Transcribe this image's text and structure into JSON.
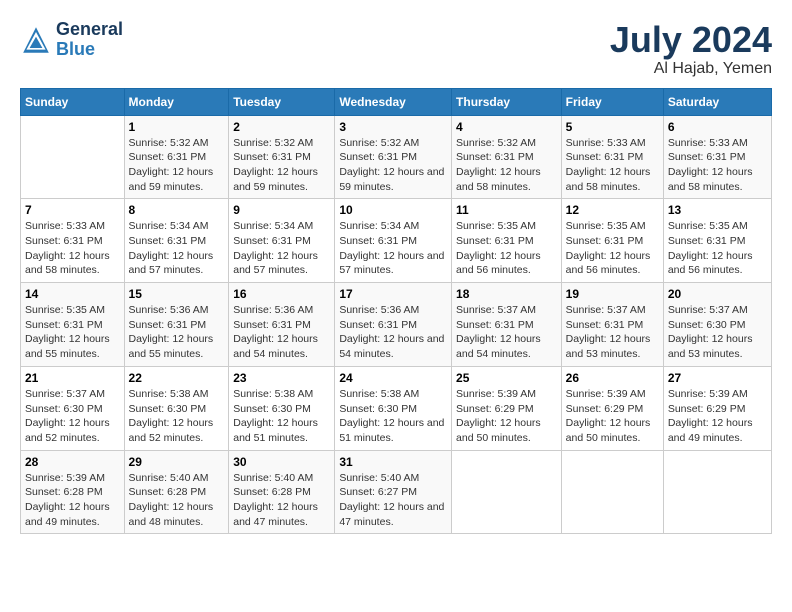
{
  "logo": {
    "general": "General",
    "blue": "Blue"
  },
  "title": {
    "month_year": "July 2024",
    "location": "Al Hajab, Yemen"
  },
  "weekdays": [
    "Sunday",
    "Monday",
    "Tuesday",
    "Wednesday",
    "Thursday",
    "Friday",
    "Saturday"
  ],
  "weeks": [
    [
      {
        "day": "",
        "sunrise": "",
        "sunset": "",
        "daylight": ""
      },
      {
        "day": "1",
        "sunrise": "Sunrise: 5:32 AM",
        "sunset": "Sunset: 6:31 PM",
        "daylight": "Daylight: 12 hours and 59 minutes."
      },
      {
        "day": "2",
        "sunrise": "Sunrise: 5:32 AM",
        "sunset": "Sunset: 6:31 PM",
        "daylight": "Daylight: 12 hours and 59 minutes."
      },
      {
        "day": "3",
        "sunrise": "Sunrise: 5:32 AM",
        "sunset": "Sunset: 6:31 PM",
        "daylight": "Daylight: 12 hours and 59 minutes."
      },
      {
        "day": "4",
        "sunrise": "Sunrise: 5:32 AM",
        "sunset": "Sunset: 6:31 PM",
        "daylight": "Daylight: 12 hours and 58 minutes."
      },
      {
        "day": "5",
        "sunrise": "Sunrise: 5:33 AM",
        "sunset": "Sunset: 6:31 PM",
        "daylight": "Daylight: 12 hours and 58 minutes."
      },
      {
        "day": "6",
        "sunrise": "Sunrise: 5:33 AM",
        "sunset": "Sunset: 6:31 PM",
        "daylight": "Daylight: 12 hours and 58 minutes."
      }
    ],
    [
      {
        "day": "7",
        "sunrise": "Sunrise: 5:33 AM",
        "sunset": "Sunset: 6:31 PM",
        "daylight": "Daylight: 12 hours and 58 minutes."
      },
      {
        "day": "8",
        "sunrise": "Sunrise: 5:34 AM",
        "sunset": "Sunset: 6:31 PM",
        "daylight": "Daylight: 12 hours and 57 minutes."
      },
      {
        "day": "9",
        "sunrise": "Sunrise: 5:34 AM",
        "sunset": "Sunset: 6:31 PM",
        "daylight": "Daylight: 12 hours and 57 minutes."
      },
      {
        "day": "10",
        "sunrise": "Sunrise: 5:34 AM",
        "sunset": "Sunset: 6:31 PM",
        "daylight": "Daylight: 12 hours and 57 minutes."
      },
      {
        "day": "11",
        "sunrise": "Sunrise: 5:35 AM",
        "sunset": "Sunset: 6:31 PM",
        "daylight": "Daylight: 12 hours and 56 minutes."
      },
      {
        "day": "12",
        "sunrise": "Sunrise: 5:35 AM",
        "sunset": "Sunset: 6:31 PM",
        "daylight": "Daylight: 12 hours and 56 minutes."
      },
      {
        "day": "13",
        "sunrise": "Sunrise: 5:35 AM",
        "sunset": "Sunset: 6:31 PM",
        "daylight": "Daylight: 12 hours and 56 minutes."
      }
    ],
    [
      {
        "day": "14",
        "sunrise": "Sunrise: 5:35 AM",
        "sunset": "Sunset: 6:31 PM",
        "daylight": "Daylight: 12 hours and 55 minutes."
      },
      {
        "day": "15",
        "sunrise": "Sunrise: 5:36 AM",
        "sunset": "Sunset: 6:31 PM",
        "daylight": "Daylight: 12 hours and 55 minutes."
      },
      {
        "day": "16",
        "sunrise": "Sunrise: 5:36 AM",
        "sunset": "Sunset: 6:31 PM",
        "daylight": "Daylight: 12 hours and 54 minutes."
      },
      {
        "day": "17",
        "sunrise": "Sunrise: 5:36 AM",
        "sunset": "Sunset: 6:31 PM",
        "daylight": "Daylight: 12 hours and 54 minutes."
      },
      {
        "day": "18",
        "sunrise": "Sunrise: 5:37 AM",
        "sunset": "Sunset: 6:31 PM",
        "daylight": "Daylight: 12 hours and 54 minutes."
      },
      {
        "day": "19",
        "sunrise": "Sunrise: 5:37 AM",
        "sunset": "Sunset: 6:31 PM",
        "daylight": "Daylight: 12 hours and 53 minutes."
      },
      {
        "day": "20",
        "sunrise": "Sunrise: 5:37 AM",
        "sunset": "Sunset: 6:30 PM",
        "daylight": "Daylight: 12 hours and 53 minutes."
      }
    ],
    [
      {
        "day": "21",
        "sunrise": "Sunrise: 5:37 AM",
        "sunset": "Sunset: 6:30 PM",
        "daylight": "Daylight: 12 hours and 52 minutes."
      },
      {
        "day": "22",
        "sunrise": "Sunrise: 5:38 AM",
        "sunset": "Sunset: 6:30 PM",
        "daylight": "Daylight: 12 hours and 52 minutes."
      },
      {
        "day": "23",
        "sunrise": "Sunrise: 5:38 AM",
        "sunset": "Sunset: 6:30 PM",
        "daylight": "Daylight: 12 hours and 51 minutes."
      },
      {
        "day": "24",
        "sunrise": "Sunrise: 5:38 AM",
        "sunset": "Sunset: 6:30 PM",
        "daylight": "Daylight: 12 hours and 51 minutes."
      },
      {
        "day": "25",
        "sunrise": "Sunrise: 5:39 AM",
        "sunset": "Sunset: 6:29 PM",
        "daylight": "Daylight: 12 hours and 50 minutes."
      },
      {
        "day": "26",
        "sunrise": "Sunrise: 5:39 AM",
        "sunset": "Sunset: 6:29 PM",
        "daylight": "Daylight: 12 hours and 50 minutes."
      },
      {
        "day": "27",
        "sunrise": "Sunrise: 5:39 AM",
        "sunset": "Sunset: 6:29 PM",
        "daylight": "Daylight: 12 hours and 49 minutes."
      }
    ],
    [
      {
        "day": "28",
        "sunrise": "Sunrise: 5:39 AM",
        "sunset": "Sunset: 6:28 PM",
        "daylight": "Daylight: 12 hours and 49 minutes."
      },
      {
        "day": "29",
        "sunrise": "Sunrise: 5:40 AM",
        "sunset": "Sunset: 6:28 PM",
        "daylight": "Daylight: 12 hours and 48 minutes."
      },
      {
        "day": "30",
        "sunrise": "Sunrise: 5:40 AM",
        "sunset": "Sunset: 6:28 PM",
        "daylight": "Daylight: 12 hours and 47 minutes."
      },
      {
        "day": "31",
        "sunrise": "Sunrise: 5:40 AM",
        "sunset": "Sunset: 6:27 PM",
        "daylight": "Daylight: 12 hours and 47 minutes."
      },
      {
        "day": "",
        "sunrise": "",
        "sunset": "",
        "daylight": ""
      },
      {
        "day": "",
        "sunrise": "",
        "sunset": "",
        "daylight": ""
      },
      {
        "day": "",
        "sunrise": "",
        "sunset": "",
        "daylight": ""
      }
    ]
  ]
}
